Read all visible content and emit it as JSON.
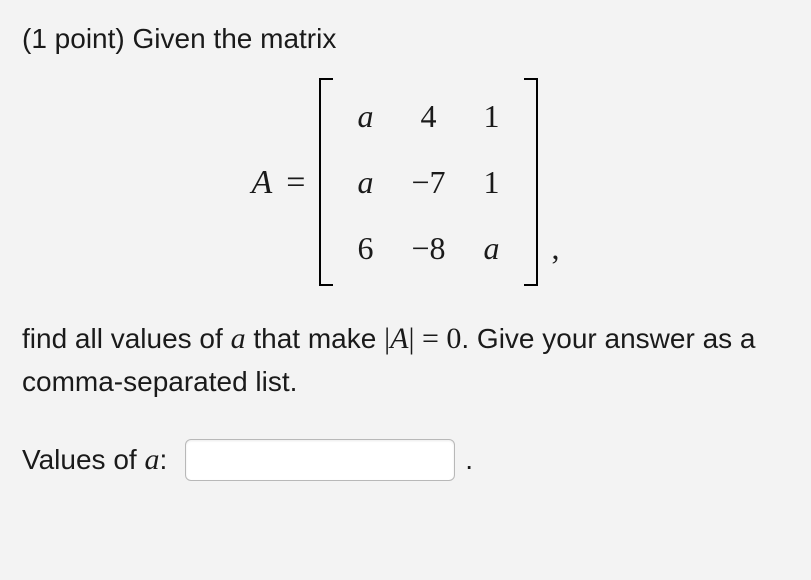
{
  "problem": {
    "points_text": "(1 point) Given the matrix",
    "matrix_label": "A",
    "equals": "=",
    "matrix": {
      "rows": [
        [
          "a",
          "4",
          "1"
        ],
        [
          "a",
          "−7",
          "1"
        ],
        [
          "6",
          "−8",
          "a"
        ]
      ]
    },
    "comma": ",",
    "question_pre": "find all values of ",
    "var_a": "a",
    "question_mid": " that make ",
    "det_open": "|",
    "det_var": "A",
    "det_close": "|",
    "eq_zero": " = 0",
    "question_post": ". Give your answer as a comma-separated list.",
    "answer_label_pre": "Values of ",
    "answer_label_var": "a",
    "answer_label_colon": ":",
    "input_value": "",
    "period": "."
  }
}
